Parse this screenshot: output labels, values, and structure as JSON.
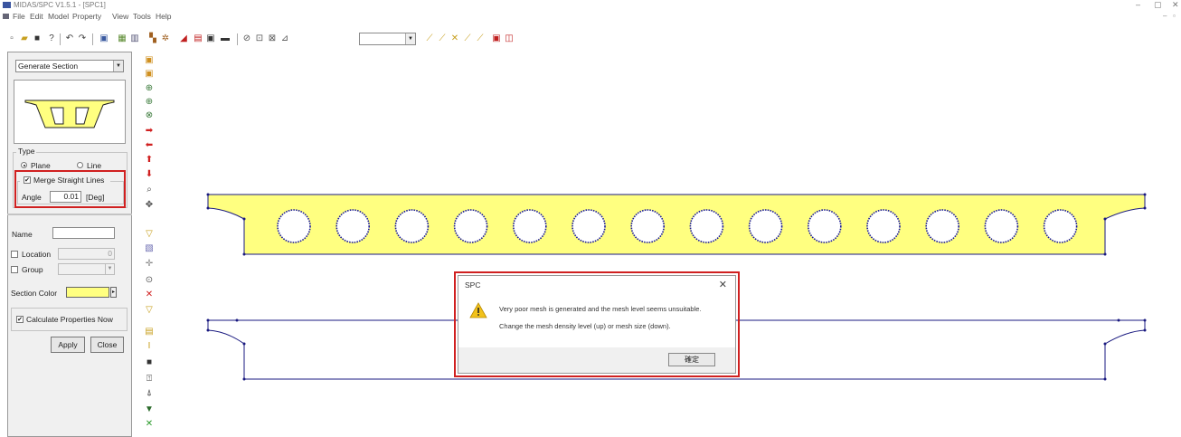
{
  "window": {
    "title": "MIDAS/SPC V1.5.1 - [SPC1]",
    "minimize": "–",
    "restore": "▢",
    "close": "✕"
  },
  "menu": {
    "items": [
      "File",
      "Edit",
      "Model",
      "Property",
      "View",
      "Tools",
      "Help"
    ],
    "mdi_minimize": "–",
    "mdi_restore": "▫"
  },
  "left_panel": {
    "mode": "Generate Section",
    "type_label": "Type",
    "plane_label": "Plane",
    "line_label": "Line",
    "type_selected": "Plane",
    "merge_label": "Merge Straight Lines",
    "merge_checked": "✔",
    "angle_label": "Angle",
    "angle_value": "0.01",
    "angle_unit": "[Deg]",
    "name_label": "Name",
    "name_value": "",
    "location_label": "Location",
    "location_value": "0",
    "group_label": "Group",
    "section_color_label": "Section Color",
    "section_color": "#ffff80",
    "calc_label": "Calculate Properties Now",
    "calc_checked": "✔",
    "apply_label": "Apply",
    "close_label": "Close"
  },
  "dialog": {
    "title": "SPC",
    "close": "✕",
    "message_line1": "Very poor mesh is generated and the mesh level seems unsuitable.",
    "message_line2": "Change the mesh density level (up) or mesh size (down).",
    "ok_label": "確定"
  },
  "colors": {
    "section_fill": "#ffff80",
    "outline": "#1a1a80",
    "highlight": "#d02020"
  }
}
